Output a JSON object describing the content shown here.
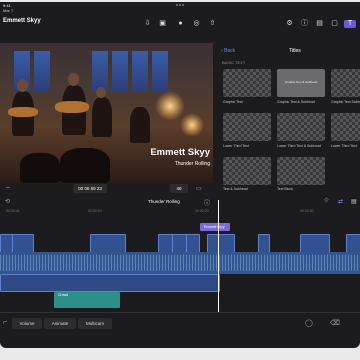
{
  "status": {
    "time": "9:41",
    "project_short": "Mar 7"
  },
  "project": {
    "title": "Emmett Skyy"
  },
  "viewer": {
    "lower_third_title": "Emmett Skyy",
    "lower_third_subtitle": "Thunder Rolling",
    "timecode": "00 06 59 23",
    "zoom": "40"
  },
  "browser": {
    "back_label": "Back",
    "title": "Titles",
    "section": "BASIC TEXT",
    "items": [
      {
        "label": "Graphic Text",
        "mini": ""
      },
      {
        "label": "Graphic Text & Subhead",
        "mini": "Graphic Text & Subhead"
      },
      {
        "label": "Graphic Text Subhead",
        "mini": ""
      },
      {
        "label": "Lower Third Text",
        "mini": ""
      },
      {
        "label": "Lower Third Text & Subhead",
        "mini": ""
      },
      {
        "label": "Lower Third Text",
        "mini": ""
      },
      {
        "label": "Text & Subhead",
        "mini": ""
      },
      {
        "label": "Text Block",
        "mini": ""
      }
    ]
  },
  "timeline": {
    "title": "Thunder Rolling",
    "title_clip": "Emmett Skyy",
    "green_clip": "Crowd",
    "ruler": [
      "00:00:01",
      "00:00:10",
      "00:00:20",
      "00:00:30"
    ]
  },
  "bottom": {
    "volume": "Volume",
    "animate": "Animate",
    "multicam": "Multicam"
  },
  "colors": {
    "accent": "#6a5ae0",
    "clip_blue": "#33508f",
    "green_clip": "#2d8f8a"
  }
}
